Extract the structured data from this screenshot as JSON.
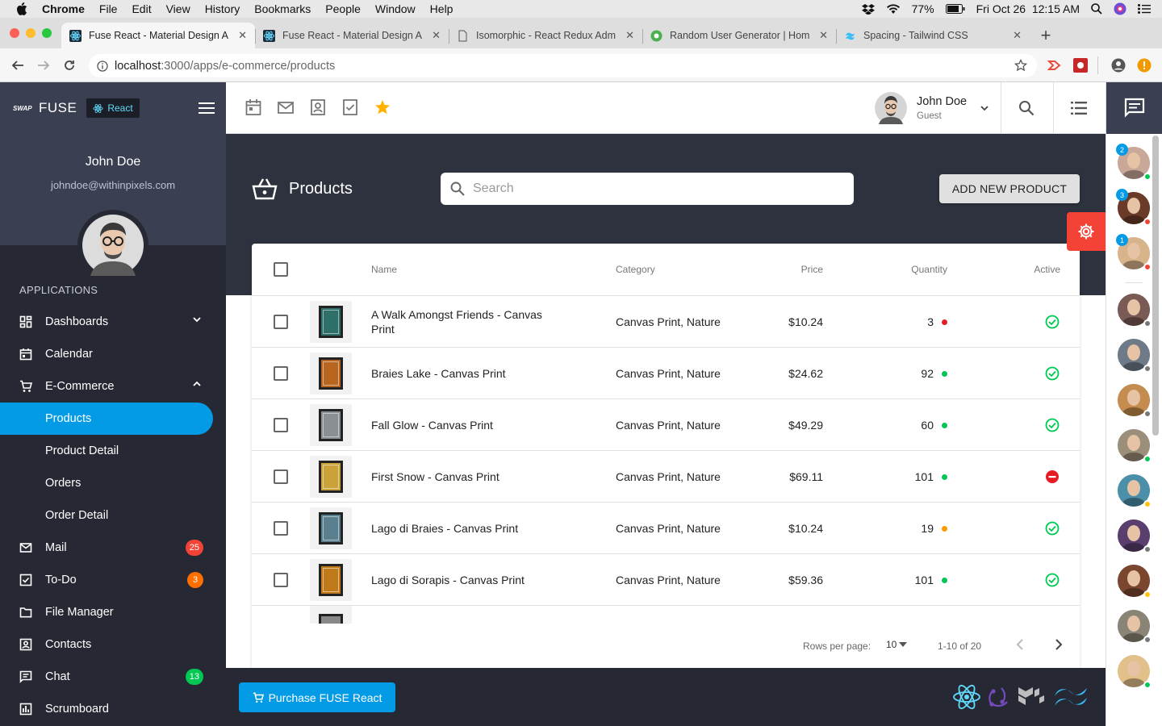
{
  "mac_menu": {
    "app": "Chrome",
    "items": [
      "File",
      "Edit",
      "View",
      "History",
      "Bookmarks",
      "People",
      "Window",
      "Help"
    ],
    "battery": "77%",
    "datetime": "Fri Oct 26  12:15 AM"
  },
  "tabs": [
    {
      "title": "Fuse React - Material Design A",
      "fav_color": "#039be5"
    },
    {
      "title": "Fuse React - Material Design A",
      "fav_color": "#039be5"
    },
    {
      "title": "Isomorphic - React Redux Adm",
      "fav_color": "#888"
    },
    {
      "title": "Random User Generator | Hom",
      "fav_color": "#4caf50"
    },
    {
      "title": "Spacing - Tailwind CSS",
      "fav_color": "#38bdf8"
    }
  ],
  "address": {
    "host": "localhost",
    "path": ":3000/apps/e-commerce/products"
  },
  "brand": {
    "logo": "FUSE",
    "badge": "React"
  },
  "user": {
    "name": "John Doe",
    "email": "johndoe@withinpixels.com",
    "role": "Guest"
  },
  "nav": {
    "section": "APPLICATIONS",
    "items": [
      {
        "label": "Dashboards",
        "icon": "dashboard-icon",
        "chevron": "down"
      },
      {
        "label": "Calendar",
        "icon": "calendar-icon"
      },
      {
        "label": "E-Commerce",
        "icon": "cart-icon",
        "chevron": "up"
      },
      {
        "label": "Products",
        "sub": true,
        "selected": true
      },
      {
        "label": "Product Detail",
        "sub": true
      },
      {
        "label": "Orders",
        "sub": true
      },
      {
        "label": "Order Detail",
        "sub": true
      },
      {
        "label": "Mail",
        "icon": "mail-icon",
        "badge": "25",
        "badge_color": "#f44336"
      },
      {
        "label": "To-Do",
        "icon": "todo-icon",
        "badge": "3",
        "badge_color": "#ff6f00"
      },
      {
        "label": "File Manager",
        "icon": "folder-icon"
      },
      {
        "label": "Contacts",
        "icon": "contacts-icon"
      },
      {
        "label": "Chat",
        "icon": "chat-icon",
        "badge": "13",
        "badge_color": "#00c853"
      },
      {
        "label": "Scrumboard",
        "icon": "scrumboard-icon"
      }
    ]
  },
  "page": {
    "title": "Products",
    "search_placeholder": "Search",
    "add_button": "ADD NEW PRODUCT"
  },
  "table": {
    "headers": {
      "name": "Name",
      "category": "Category",
      "price": "Price",
      "quantity": "Quantity",
      "active": "Active"
    },
    "rows": [
      {
        "name": "A Walk Amongst Friends - Canvas Print",
        "category": "Canvas Print, Nature",
        "price": "$10.24",
        "quantity": "3",
        "qcolor": "#e51c23",
        "active": true,
        "thumb": "#2f6f6a"
      },
      {
        "name": "Braies Lake - Canvas Print",
        "category": "Canvas Print, Nature",
        "price": "$24.62",
        "quantity": "92",
        "qcolor": "#00c853",
        "active": true,
        "thumb": "#b8661f"
      },
      {
        "name": "Fall Glow - Canvas Print",
        "category": "Canvas Print, Nature",
        "price": "$49.29",
        "quantity": "60",
        "qcolor": "#00c853",
        "active": true,
        "thumb": "#8a8f94"
      },
      {
        "name": "First Snow - Canvas Print",
        "category": "Canvas Print, Nature",
        "price": "$69.11",
        "quantity": "101",
        "qcolor": "#00c853",
        "active": false,
        "thumb": "#c9a23a"
      },
      {
        "name": "Lago di Braies - Canvas Print",
        "category": "Canvas Print, Nature",
        "price": "$10.24",
        "quantity": "19",
        "qcolor": "#ff9800",
        "active": true,
        "thumb": "#5a7f8f"
      },
      {
        "name": "Lago di Sorapis - Canvas Print",
        "category": "Canvas Print, Nature",
        "price": "$59.36",
        "quantity": "101",
        "qcolor": "#00c853",
        "active": true,
        "thumb": "#c07a1a"
      }
    ]
  },
  "pagination": {
    "rows_label": "Rows per page:",
    "rows_value": "10",
    "range": "1-10 of 20"
  },
  "footer": {
    "buy_label": "Purchase FUSE React"
  },
  "chat_contacts": [
    {
      "badge": "2",
      "status": "#00c853",
      "color": "#c9a89a"
    },
    {
      "badge": "3",
      "status": "#f44336",
      "color": "#6b3b2a"
    },
    {
      "badge": "1",
      "status": "#f44336",
      "color": "#d8b48a"
    },
    {
      "status": "#777",
      "color": "#7a5a55"
    },
    {
      "status": "#777",
      "color": "#6e7a88"
    },
    {
      "status": "#777",
      "color": "#c48c4e"
    },
    {
      "status": "#00c853",
      "color": "#9b8e7a"
    },
    {
      "status": "#ffc107",
      "color": "#4c8fa8"
    },
    {
      "status": "#777",
      "color": "#5a3e6e"
    },
    {
      "status": "#ffc107",
      "color": "#7a4630"
    },
    {
      "status": "#777",
      "color": "#8a8476"
    },
    {
      "status": "#00c853",
      "color": "#e2c08a"
    }
  ]
}
